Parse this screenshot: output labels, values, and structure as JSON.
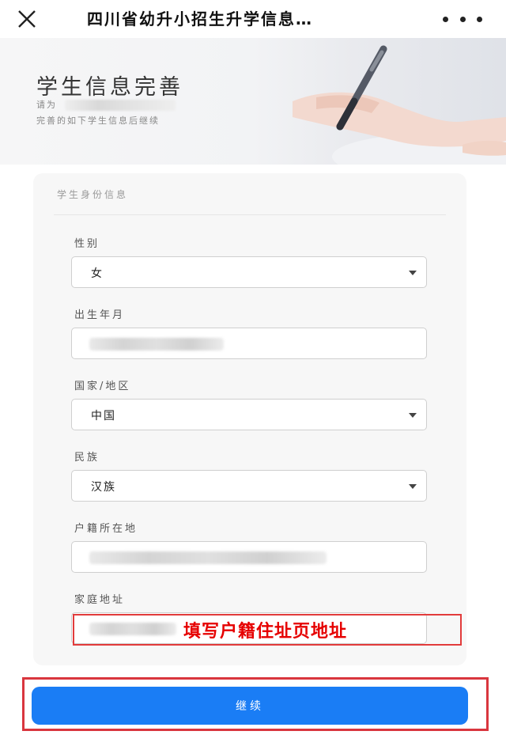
{
  "header": {
    "title": "四川省幼升小招生升学信息…",
    "close_icon": "close-icon",
    "more_icon": "more-icon"
  },
  "banner": {
    "title": "学生信息完善",
    "line1_prefix": "请为",
    "line2": "完善的如下学生信息后继续"
  },
  "form": {
    "section_title": "学生身份信息",
    "fields": [
      {
        "label": "性别",
        "value": "女",
        "type": "select"
      },
      {
        "label": "出生年月",
        "value": "",
        "type": "input"
      },
      {
        "label": "国家/地区",
        "value": "中国",
        "type": "select"
      },
      {
        "label": "民族",
        "value": "汉族",
        "type": "select"
      },
      {
        "label": "户籍所在地",
        "value": "",
        "type": "input"
      },
      {
        "label": "家庭地址",
        "value": "",
        "type": "input"
      }
    ],
    "annotation": "填写户籍住址页地址",
    "annotation_color": "#e60000"
  },
  "actions": {
    "continue_label": "继续",
    "button_color": "#1a7df5"
  }
}
